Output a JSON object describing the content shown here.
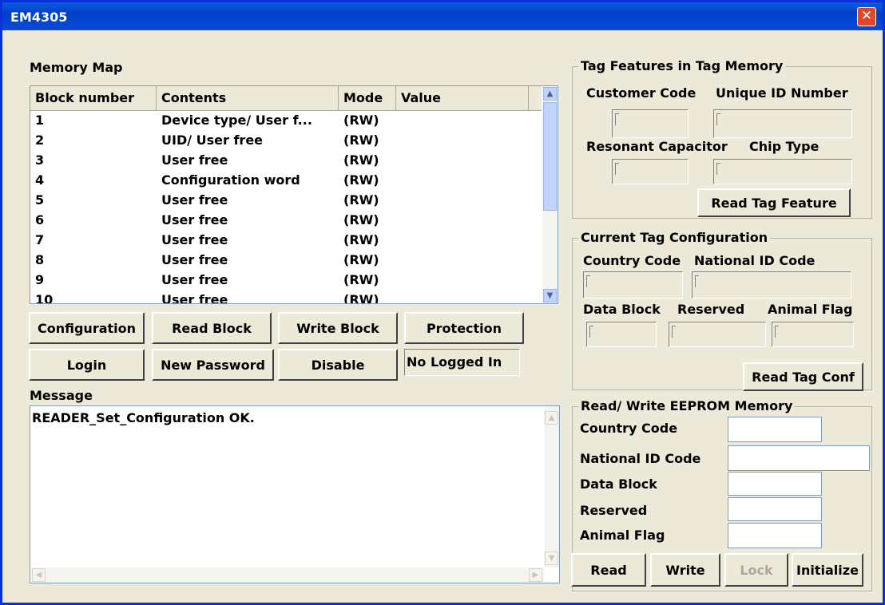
{
  "window": {
    "title": "EM4305",
    "close_glyph": "✕"
  },
  "memory_map": {
    "label": "Memory Map",
    "columns": [
      "Block number",
      "Contents",
      "Mode",
      "Value"
    ],
    "rows": [
      {
        "block": "1",
        "contents": "Device type/ User f...",
        "mode": "(RW)",
        "value": ""
      },
      {
        "block": "2",
        "contents": "UID/ User free",
        "mode": "(RW)",
        "value": ""
      },
      {
        "block": "3",
        "contents": "User free",
        "mode": "(RW)",
        "value": ""
      },
      {
        "block": "4",
        "contents": "Configuration word",
        "mode": "(RW)",
        "value": ""
      },
      {
        "block": "5",
        "contents": "User free",
        "mode": "(RW)",
        "value": ""
      },
      {
        "block": "6",
        "contents": "User free",
        "mode": "(RW)",
        "value": ""
      },
      {
        "block": "7",
        "contents": "User free",
        "mode": "(RW)",
        "value": ""
      },
      {
        "block": "8",
        "contents": "User free",
        "mode": "(RW)",
        "value": ""
      },
      {
        "block": "9",
        "contents": "User free",
        "mode": "(RW)",
        "value": ""
      },
      {
        "block": "10",
        "contents": "User free",
        "mode": "(RW)",
        "value": ""
      }
    ]
  },
  "buttons": {
    "configuration": "Configuration",
    "read_block": "Read Block",
    "write_block": "Write Block",
    "protection": "Protection",
    "login": "Login",
    "new_password": "New Password",
    "disable": "Disable"
  },
  "login_status": "No Logged In",
  "message": {
    "label": "Message",
    "text": "READER_Set_Configuration OK."
  },
  "tag_features": {
    "title": "Tag Features in Tag Memory",
    "customer_code_label": "Customer Code",
    "unique_id_label": "Unique ID Number",
    "resonant_capacitor_label": "Resonant Capacitor",
    "chip_type_label": "Chip Type",
    "read_button": "Read Tag Feature"
  },
  "current_config": {
    "title": "Current Tag Configuration",
    "country_code_label": "Country Code",
    "national_id_label": "National ID Code",
    "data_block_label": "Data Block",
    "reserved_label": "Reserved",
    "animal_flag_label": "Animal Flag",
    "read_button": "Read Tag Conf"
  },
  "eeprom": {
    "title": "Read/ Write EEPROM Memory",
    "country_code_label": "Country Code",
    "national_id_label": "National ID Code",
    "data_block_label": "Data Block",
    "reserved_label": "Reserved",
    "animal_flag_label": "Animal Flag",
    "read_button": "Read",
    "write_button": "Write",
    "lock_button": "Lock",
    "initialize_button": "Initialize"
  }
}
